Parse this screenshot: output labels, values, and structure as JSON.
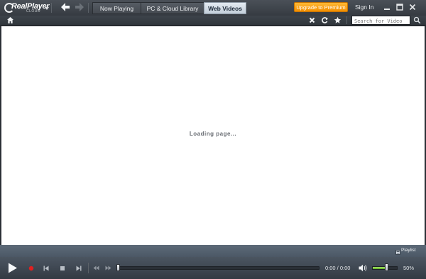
{
  "app": {
    "logo_text": "RealPlayer",
    "logo_sub": "CLOUD"
  },
  "titlebar": {
    "tabs": [
      {
        "label": "Now Playing",
        "active": false
      },
      {
        "label": "PC & Cloud Library",
        "active": false
      },
      {
        "label": "Web Videos",
        "active": true
      }
    ],
    "premium_label": "Upgrade to Premium",
    "signin_label": "Sign In",
    "window_icons": [
      "minimize-icon",
      "maximize-icon",
      "close-icon"
    ]
  },
  "toolbar": {
    "icons": [
      "home-icon",
      "stop-loading-icon",
      "refresh-icon",
      "favorite-star-icon",
      "search-icon"
    ],
    "search_placeholder": "Search for Video"
  },
  "content": {
    "status_text": "Loading page..."
  },
  "playlist": {
    "label": "Playlist"
  },
  "transport": {
    "icons": [
      "play-icon",
      "record-icon",
      "previous-icon",
      "stop-icon",
      "next-icon",
      "rewind-icon",
      "fast-forward-icon",
      "volume-icon"
    ],
    "time_text": "0:00 / 0:00",
    "position": 0,
    "volume": 0.5,
    "volume_text": "50%"
  },
  "colors": {
    "accent_premium": "#f5a000",
    "record_red": "#e02020",
    "volume_green": "#7ccb3a",
    "active_tab": "#d8e2ec"
  }
}
